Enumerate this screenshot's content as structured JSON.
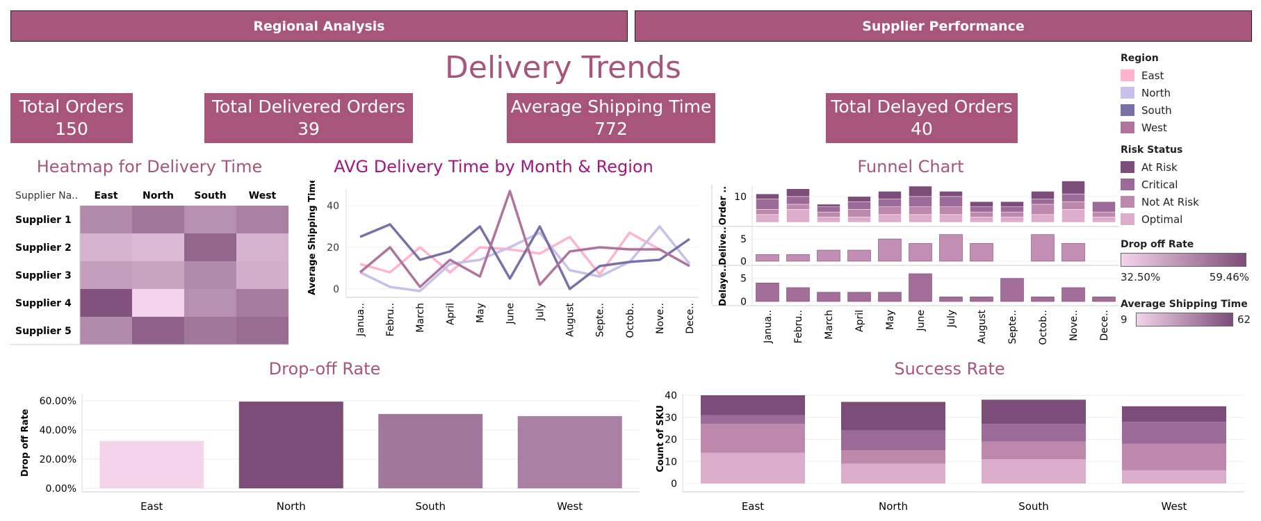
{
  "nav": {
    "regional": "Regional Analysis",
    "supplier": "Supplier Performance"
  },
  "title": "Delivery Trends",
  "kpis": [
    {
      "label": "Total Orders",
      "value": "150"
    },
    {
      "label": "Total Delivered Orders",
      "value": "39"
    },
    {
      "label": "Average Shipping Time",
      "value": "772"
    },
    {
      "label": "Total Delayed Orders",
      "value": "40"
    }
  ],
  "colors": {
    "brand": "#a8557c",
    "East": "#ffb3cc",
    "North": "#c6c0ea",
    "South": "#7b6fa8",
    "West": "#b0739c",
    "At Risk": "#7d4d79",
    "Critical": "#9b6a98",
    "Not At Risk": "#be88ac",
    "Optimal": "#dcaccb"
  },
  "legend": {
    "region": {
      "title": "Region",
      "items": [
        "East",
        "North",
        "South",
        "West"
      ]
    },
    "risk": {
      "title": "Risk Status",
      "items": [
        "At Risk",
        "Critical",
        "Not At Risk",
        "Optimal"
      ]
    },
    "dropoff": {
      "title": "Drop off Rate",
      "min": "32.50%",
      "max": "59.46%"
    },
    "shipping": {
      "title": "Average Shipping Time",
      "min": "9",
      "max": "62"
    }
  },
  "chart_data": [
    {
      "type": "heatmap",
      "title": "Heatmap for Delivery Time",
      "row_header": "Supplier Na..",
      "columns": [
        "East",
        "North",
        "South",
        "West"
      ],
      "rows": [
        "Supplier 1",
        "Supplier 2",
        "Supplier 3",
        "Supplier 4",
        "Supplier 5"
      ],
      "values": [
        [
          38,
          46,
          36,
          42
        ],
        [
          22,
          20,
          52,
          22
        ],
        [
          30,
          28,
          38,
          24
        ],
        [
          60,
          9,
          36,
          44
        ],
        [
          38,
          54,
          46,
          50
        ]
      ],
      "color_range": [
        9,
        62
      ]
    },
    {
      "type": "line",
      "title": "AVG Delivery Time by Month & Region",
      "ylabel": "Average Shipping Time",
      "categories": [
        "Janua..",
        "Febru..",
        "March",
        "April",
        "May",
        "June",
        "July",
        "August",
        "Septe..",
        "Octob..",
        "Nove..",
        "Dece.."
      ],
      "yticks": [
        0,
        20,
        40
      ],
      "ylim": [
        0,
        48
      ],
      "series": [
        {
          "name": "East",
          "values": [
            12,
            8,
            20,
            8,
            20,
            19,
            17,
            25,
            7,
            27,
            19,
            11
          ]
        },
        {
          "name": "North",
          "values": [
            8,
            1,
            -1,
            12,
            14,
            20,
            27,
            9,
            6,
            13,
            30,
            12
          ]
        },
        {
          "name": "South",
          "values": [
            25,
            31,
            14,
            18,
            30,
            5,
            30,
            0,
            11,
            13,
            14,
            24
          ]
        },
        {
          "name": "West",
          "values": [
            8,
            20,
            1,
            14,
            6,
            47,
            2,
            18,
            20,
            19,
            19,
            11
          ]
        }
      ]
    },
    {
      "type": "bar",
      "title": "Funnel Chart",
      "categories": [
        "Janua..",
        "Febru..",
        "March",
        "April",
        "May",
        "June",
        "July",
        "August",
        "Septe..",
        "Octob..",
        "Nove..",
        "Dece.."
      ],
      "panels": [
        {
          "label": "Order ..",
          "yticks": [
            10
          ],
          "ylim": [
            0,
            14
          ],
          "stack_order": [
            "Optimal",
            "Not At Risk",
            "Critical",
            "At Risk"
          ],
          "stacks": [
            [
              3,
              2,
              4,
              2
            ],
            [
              5,
              2,
              3,
              3
            ],
            [
              2,
              2,
              2,
              1
            ],
            [
              2,
              3,
              3,
              2
            ],
            [
              3,
              3,
              3,
              3
            ],
            [
              3,
              3,
              4,
              4
            ],
            [
              3,
              3,
              4,
              2
            ],
            [
              2,
              2,
              2,
              2
            ],
            [
              2,
              2,
              2,
              2
            ],
            [
              3,
              4,
              2,
              3
            ],
            [
              5,
              3,
              3,
              5
            ],
            [
              2,
              2,
              4,
              0
            ]
          ]
        },
        {
          "label": "Delive..",
          "yticks": [
            0,
            5
          ],
          "ylim": [
            0,
            7.5
          ],
          "values": [
            1.5,
            1.5,
            2.5,
            2.5,
            5,
            4,
            6,
            4,
            0,
            6,
            4,
            0
          ]
        },
        {
          "label": "Delaye..",
          "yticks": [
            0,
            5
          ],
          "ylim": [
            0,
            7.5
          ],
          "values": [
            4,
            3,
            2,
            2,
            2,
            6,
            1,
            1,
            5,
            1,
            3,
            1
          ]
        }
      ]
    },
    {
      "type": "bar",
      "title": "Drop-off Rate",
      "ylabel": "Drop off Rate",
      "categories": [
        "East",
        "North",
        "South",
        "West"
      ],
      "values": [
        32.5,
        59.46,
        51.0,
        49.5
      ],
      "yticks": [
        "0.00%",
        "20.00%",
        "40.00%",
        "60.00%"
      ],
      "ylim": [
        0,
        60
      ]
    },
    {
      "type": "bar",
      "title": "Success Rate",
      "ylabel": "Count of SKU",
      "categories": [
        "East",
        "North",
        "South",
        "West"
      ],
      "yticks": [
        0,
        10,
        20,
        30,
        40
      ],
      "ylim": [
        0,
        40
      ],
      "stack_order": [
        "Optimal",
        "Not At Risk",
        "Critical",
        "At Risk"
      ],
      "stacks": [
        [
          14,
          13,
          4,
          9
        ],
        [
          9,
          6,
          9,
          13
        ],
        [
          11,
          8,
          8,
          11
        ],
        [
          6,
          12,
          10,
          7
        ]
      ]
    }
  ]
}
